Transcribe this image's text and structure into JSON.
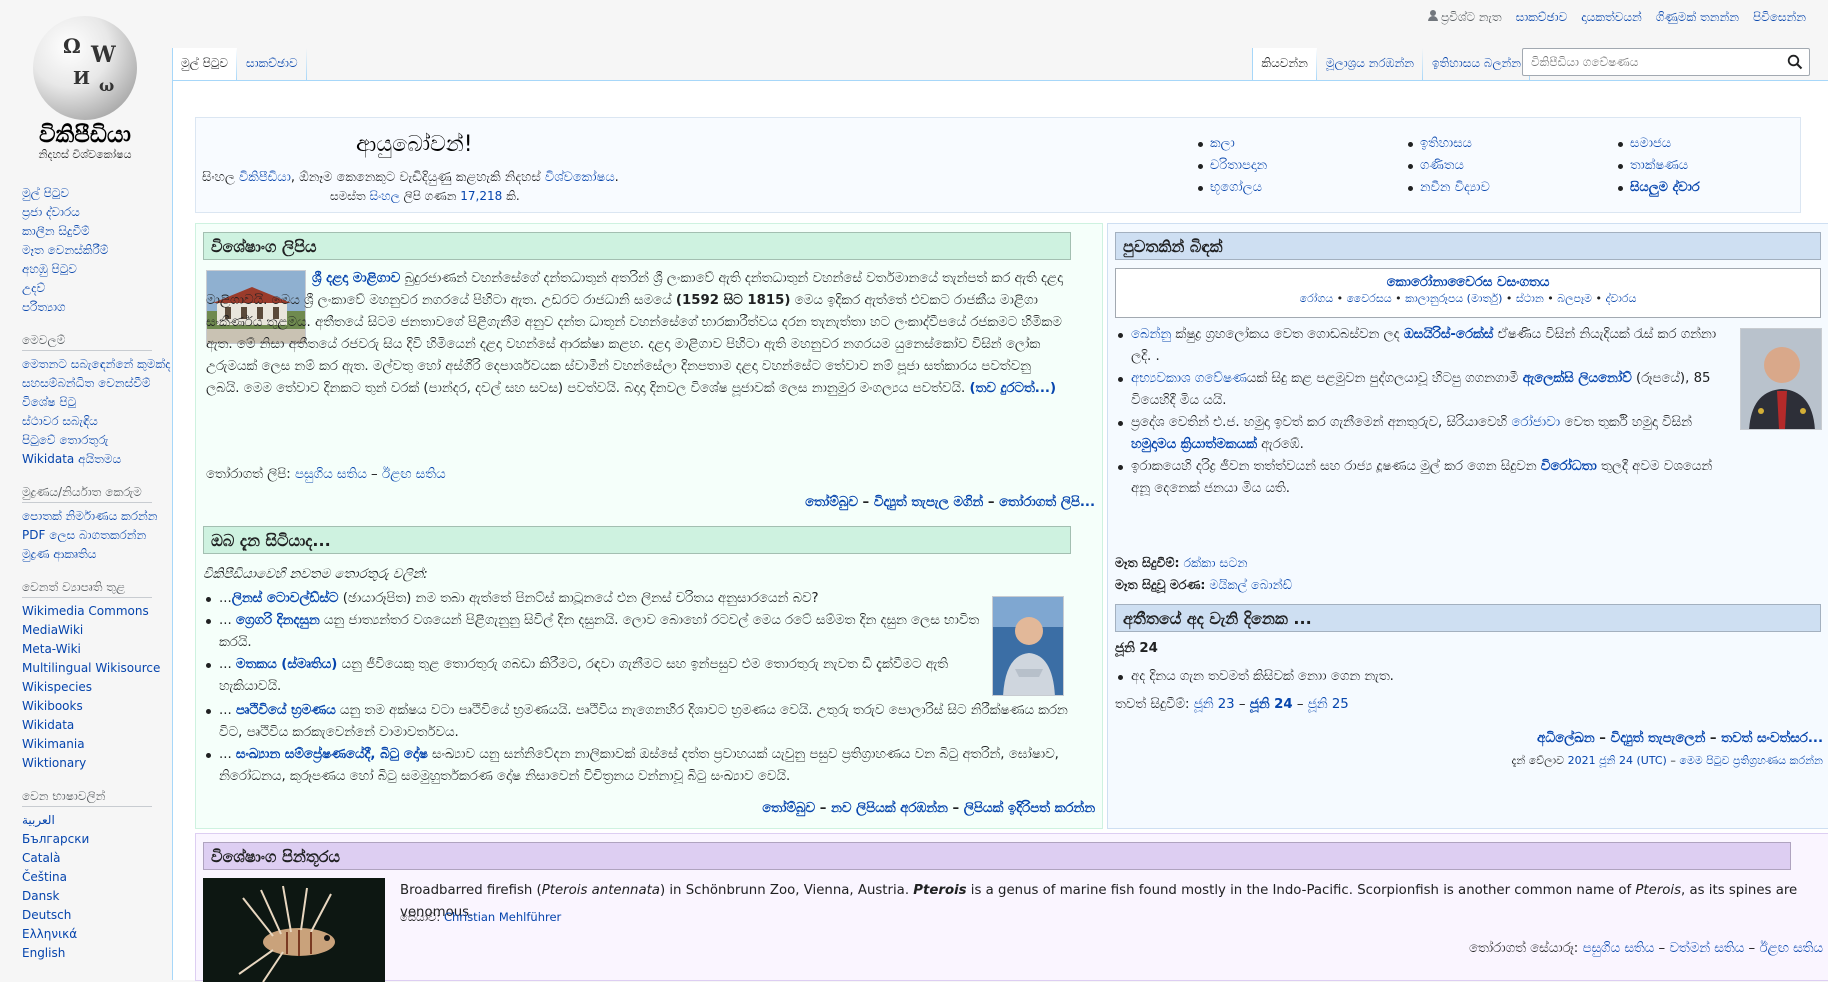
{
  "logo": {
    "wordmark": "විකිපීඩියා",
    "tagline": "නිදහස් විශ්වකෝෂය",
    "globe_letters": [
      "Ω",
      "W",
      "И",
      "ω"
    ]
  },
  "sidebar": {
    "main": [
      "මුල් පිටුව",
      "ප්‍රජා ද්වාරය",
      "කාලීන සිදුවීම්",
      "මෑත වෙනස්කිරීම්",
      "අහඹු පිටුව",
      "උදව්",
      "පරිත්‍යාග"
    ],
    "tools_head": "මෙවලම්",
    "tools": [
      "මෙතනට සබැඳෙන්නේ කුමක්ද",
      "සහසම්බන්ධිත වෙනස්වීම්",
      "විශේෂ පිටු",
      "ස්ථාවර සබැඳිය",
      "පිටුවේ තොරතුරු",
      "Wikidata අයිතමය"
    ],
    "print_head": "මුද්‍රණය/නිර්යාත කෙරුම",
    "print": [
      "පොතක් නිර්මාණය කරන්න",
      "PDF ලෙස බාගතකරන්න",
      "මුද්‍රණ ආකෘතිය"
    ],
    "projects_head": "වෙනත් ව්‍යාපෘති තුළ",
    "projects": [
      "Wikimedia Commons",
      "MediaWiki",
      "Meta-Wiki",
      "Multilingual Wikisource",
      "Wikispecies",
      "Wikibooks",
      "Wikidata",
      "Wikimania",
      "Wiktionary"
    ],
    "languages_head": "වෙන භාෂාවලින්",
    "languages": [
      "العربية",
      "Български",
      "Català",
      "Čeština",
      "Dansk",
      "Deutsch",
      "Ελληνικά",
      "English"
    ]
  },
  "personal": [
    "ප්‍රවිශ්ට නැත",
    "සාකච්ඡාව",
    "දායකත්වයන්",
    "ගිණුමක් තනන්න",
    "පිවිසෙන්න"
  ],
  "tabs_left": [
    "මුල් පිටුව",
    "සාකච්ඡාව"
  ],
  "tabs_right": [
    "කියවන්න",
    "මූලාශ්‍රය නරඹන්න",
    "ඉතිහාසය බලන්න"
  ],
  "search": {
    "placeholder": "විකිපීඩියා ගවේෂණය"
  },
  "welcome": {
    "hello": "ආයුබෝවන්!",
    "line1_a": "සිංහල ",
    "line1_link1": "විකිපීඩියා",
    "line1_b": ", ඕනෑම කෙනෙකුට වැඩිදියුණු කළහැකි නිදහස් ",
    "line1_link2": "විශ්වකෝෂය",
    "line1_c": ".",
    "line2_a": "සමස්ත ",
    "line2_link": "සිංහල",
    "line2_b": " ලිපි ගණන ",
    "line2_count": "17,218",
    "line2_c": " කි."
  },
  "portals": [
    "කලා",
    "ඉතිහාසය",
    "සමාජය",
    "චරිතාපදාන",
    "ගණිතය",
    "තාක්ෂණය",
    "භූගෝලය",
    "නවීන විද්‍යාව",
    "සියලුම ද්වාර"
  ],
  "featured": {
    "title": "විශේෂාංග ලිපිය",
    "lead_link": "ශ්‍රී දළදා මාළිගාව",
    "body_1": " බුදුරජාණන් වහන්සේගේ දන්තධාතුන් අතරින් ශ්‍රී ලංකාවේ ඇති දන්තධාතුන් වහන්සේ වර්තමානයේ තැන්පත් කර ඇති දළදා මාළිගාවයි. මෙය ශ්‍රී ලංකාවේ මහනුවර නගරයේ පිහිටා ඇත. උඩරට රාජධානි සමයේ ",
    "body_years": "(1592 සිට 1815)",
    "body_2": " මෙය ඉදිකර ඇත්තේ එවකට රාජකීය මාළිගා සංකීර්ණය තුළමය. අතීතයේ සිටම ජනතාවගේ පිළිගැනීම අනුව දන්ත ධාතූන් වහන්සේගේ භාරකාරීත්වය දරන තැනැත්තා හට ලංකාද්වීපයේ රජකමට හිමිකම ඇත. මේ නිසා අතීතයේ රජවරු සිය දිවි හිමියෙන් දළදා වහන්සේ ආරක්ෂා කළහ. දළදා මාළිගාව පිහිටා ඇති මහනුවර නගරයම යුනෙස්කෝව විසින් ලෝක උරුමයක් ලෙස නම් කර ඇත. මල්වතු හෝ අස්ගිරි දෙපාර්ශවයක ස්වාමීන් වහන්සේලා දිනපතාම දළදා වහන්සේට තේවාව නම් පූජා සත්කාරය පවත්වනු ලබයි. මෙම තේවාව දිනකට තුන් වරක් (පාන්දර, දවල් සහ සවස) පවත්වයි. බදාදා දිනවල විශේෂ පූජාවක් ලෙස නානුමුර මංගල්‍යය පවත්වයි.",
    "more": "(තව දුරටත්...)",
    "recent_label": "තෝරාගත් ලිපි: ",
    "recent_1": "පසුගිය සතිය",
    "recent_sep": " – ",
    "recent_2": "ඊළඟ සතිය",
    "footer_1": "තෝම්බුව",
    "footer_2": "විද්‍යුත් තැපැල මගින්",
    "footer_3": "තෝරාගත් ලිපි..."
  },
  "dyk": {
    "title": "ඔබ දැන සිටියාද...",
    "intro": "විකිපීඩියාවෙහි නවතම තොරතුරු වලින්:",
    "items": [
      {
        "pre": "...",
        "link": "ලිනස් ටොවල්ඩ්ස්ට",
        "rest": " (ඡායාරූපිත) නම තබා ඇත්තේ පිනට්ස් කාටූනයේ එන ලිනස් චරිතය අනුසාරයෙන් බව?"
      },
      {
        "pre": "... ",
        "link": "ග්‍රෙගරි දිනදසුන",
        "rest": " යනු ජාත්‍යන්තර වශයෙන් පිළිගැනුනු සිවිල් දින දසුනයි. ලොව බොහෝ රටවල් මෙය රටේ සම්මත දින දසුන ලෙස භාවිත කරයි."
      },
      {
        "pre": "... ",
        "link": "මතකය (ස්මෘතිය)",
        "rest": " යනු ජීවියෙකු තුළ තොරතුරු ගබඩා කිරීමට, රඳවා ගැනීමට සහ ඉන්පසුව එම තොරතුරු නැවත ඩී දැක්වීමට ඇති හැකියාවයි."
      },
      {
        "pre": "... ",
        "link": "පෘථිවියේ භ්‍රමණය",
        "rest": " යනු තම අක්ෂය වටා පෘථිවියේ භ්‍රමණයයි. පෘථිවිය නැගෙනහිර දිශාවට භ්‍රමණය වෙයි. උතුරු තරුව පොලාරිස් සිට නිරීක්ෂණය කරන විට, පෘථිවිය කරකැවෙන්නේ වාමාවර්තවය."
      },
      {
        "pre": "... ",
        "link": "සංඛ්‍යාන සම්ප්‍රේෂණයේදී, බිටු දෝෂ",
        "rest": " සංඛ්‍යාව යනු සන්නිවේදන නාලිකාවක් ඔස්සේ දත්ත ප්‍රවාහයක් යැවුනු පසුව ප්‍රතිග්‍රාහණය වන බිටු අතරින්, ඝෝෂාව, නිරෝධනය, කුරූපණය හෝ බිටු සමමුහුර්තකරණ දෝෂ නිසාවෙන් විචිත්‍රනය වන්නාවූ බිටු සංඛ්‍යාව වෙයි."
      }
    ],
    "footer_1": "තෝම්බුව",
    "footer_2": "නව ලිපියක් අරඹන්න",
    "footer_3": "ලිපියක් ඉදිරිපත් කරන්න"
  },
  "news": {
    "title": "පුවතකින් බිඳක්",
    "banner_title": "කොරෝනාවෛරස වසංගතය",
    "banner_links": [
      "රෝගය",
      "වෛරසය",
      "කාලානුරූපය (මාර්තු)",
      "ස්ථාන",
      "බලපෑම",
      "ද්වාරය"
    ],
    "items": [
      {
        "a": "",
        "l1": "බෙන්නු",
        "b": " ක්ෂුද්‍ර ග්‍රහලෝකය වෙත ගොඩබස්වන ලද ",
        "l2": "ඔසයිරිස්-රෙක්ස්",
        "c": " ඒෂණිය විසින් නියැදියක් රැස් කර ගන්නා ලදි. ."
      },
      {
        "a": "",
        "l1": "අභ්‍යවකාශ ගවේෂණ",
        "b": "යක් සිදු කළ පළමුවන පුද්ගලයාවූ හිටපු ගගනගාමී ",
        "l2": "ඇලෙක්සි ලියනෝව්",
        "c": " (රූපයේ), 85 වියෙහිදී මිය යයි."
      },
      {
        "a": "ප්‍රදේශ වෙතින් එ.ජ. හමුදා ඉවත් කර ගැනීමෙන් අනතුරුව, සිරියාවෙහි ",
        "l1": "රෝජාවා",
        "b": " වෙත තුර්කි හමුදා විසින් ",
        "l2": "හමුදාමය ක්‍රියාත්මකයක්",
        "c": " ඇරඹේ."
      },
      {
        "a": "ඉරාකයෙහි දරිද්‍ර ජීවන තත්ත්වයන් සහ රාජ්‍ය දූෂණය මුල් කර ගෙන සිදුවන ",
        "l1": "",
        "b": "",
        "l2": "විරෝධතා",
        "c": " තුලදී අවම වශයෙන් අනූ දෙනෙක් ජනයා මිය යති."
      }
    ],
    "recent_label": "මෑත සිදුවීම්:",
    "recent_value": "රක්කා සටන",
    "deaths_label": "මෑත සිදුවූ මරණ:",
    "deaths_value": "මයිකල් බොන්ඩ්"
  },
  "otd": {
    "title": "අතීතයේ අද වැනි දිනෙක ...",
    "date": "ජූනි 24",
    "item": "අද දිනය ගැන තවමත් කිසිවක් නොා ගෙන නැත.",
    "other_label": "තවත් සිදුවීම්: ",
    "d1": "ජූනි 23",
    "d2": "ජූනි 24",
    "d3": "ජූනි 25",
    "footer_1": "අධිලේඛන",
    "footer_2": "විද්‍යුත් තැපැලෙන්",
    "footer_3": "තවත් සංවත්සර...",
    "time_prefix": "දැන් වේලාව ",
    "time_value": "2021 ජූනි 24 (UTC)",
    "time_sep": " – ",
    "time_link": "මෙම පිටුව ප්‍රතිග්‍රහණය කරන්න"
  },
  "potd": {
    "title": "විශේෂාංග පින්තූරය",
    "caption_1": "Broadbarred firefish (",
    "caption_italic1": "Pterois antennata",
    "caption_2": ") in Schönbrunn Zoo, Vienna, Austria. ",
    "caption_bold": "Pterois",
    "caption_3": " is a genus of marine fish found mostly in the Indo-Pacific. Scorpionfish is another common name of ",
    "caption_italic2": "Pterois",
    "caption_4": ", as its spines are venomous.",
    "credit_label": "සේයාව: ",
    "credit_name": "Christian Mehlführer",
    "footer_label": "තෝරාගත් සේයාරූ: ",
    "footer_1": "පසුගිය සතිය",
    "footer_2": "වත්මන් සතිය",
    "footer_3": "ඊළඟ සතිය"
  },
  "dash": " – ",
  "dot": " • ",
  "colors": {
    "link": "#0645ad",
    "green_head": "#cef2e0",
    "blue_head": "#cedff2",
    "purple_head": "#ddcef2"
  }
}
